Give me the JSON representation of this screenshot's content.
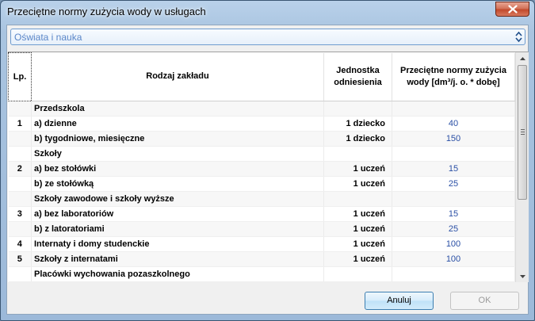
{
  "window": {
    "title": "Przeciętne normy zużycia wody w usługach"
  },
  "combo": {
    "selected": "Oświata i nauka"
  },
  "table": {
    "headers": {
      "lp": "Lp.",
      "name": "Rodzaj zakładu",
      "unit_line1": "Jednostka",
      "unit_line2": "odniesienia",
      "norm_line1": "Przeciętne normy zużycia",
      "norm_line2": "wody [dm³/j. o. * dobę]"
    },
    "rows": [
      {
        "lp": "",
        "name": "Przedszkola",
        "unit": "",
        "value": ""
      },
      {
        "lp": "1",
        "name": "a) dzienne",
        "unit": "1 dziecko",
        "value": "40"
      },
      {
        "lp": "",
        "name": "b) tygodniowe, miesięczne",
        "unit": "1 dziecko",
        "value": "150"
      },
      {
        "lp": "",
        "name": "Szkoły",
        "unit": "",
        "value": ""
      },
      {
        "lp": "2",
        "name": "a) bez stołówki",
        "unit": "1 uczeń",
        "value": "15"
      },
      {
        "lp": "",
        "name": "b) ze stołówką",
        "unit": "1 uczeń",
        "value": "25"
      },
      {
        "lp": "",
        "name": "Szkoły zawodowe i szkoły wyższe",
        "unit": "",
        "value": ""
      },
      {
        "lp": "3",
        "name": "a) bez laboratoriów",
        "unit": "1 uczeń",
        "value": "15"
      },
      {
        "lp": "",
        "name": "b) z latoratoriami",
        "unit": "1 uczeń",
        "value": "25"
      },
      {
        "lp": "4",
        "name": "Internaty i domy studenckie",
        "unit": "1 uczeń",
        "value": "100"
      },
      {
        "lp": "5",
        "name": "Szkoły z internatami",
        "unit": "1 uczeń",
        "value": "100"
      },
      {
        "lp": "",
        "name": "Placówki wychowania pozaszkolnego",
        "unit": "",
        "value": ""
      }
    ]
  },
  "buttons": {
    "cancel": "Anuluj",
    "ok": "OK"
  }
}
